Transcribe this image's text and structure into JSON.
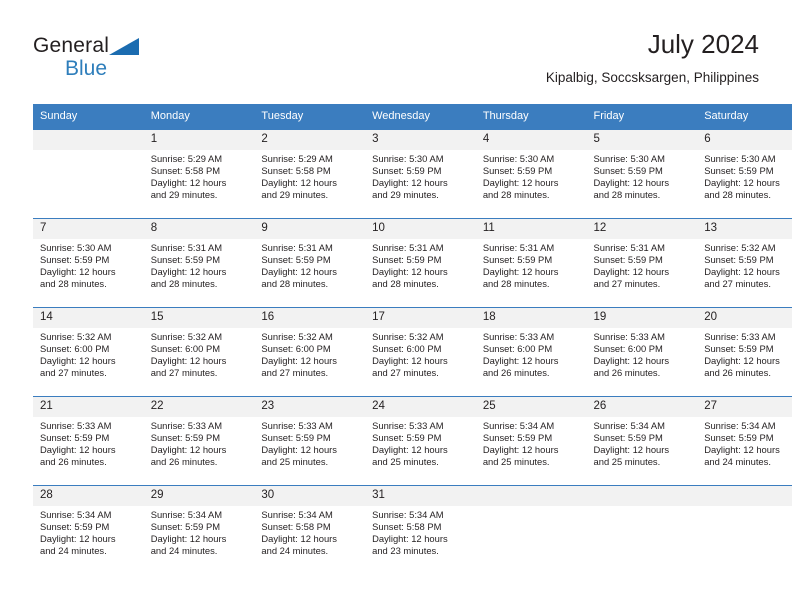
{
  "brand": {
    "name_top": "General",
    "name_bottom": "Blue",
    "triangle_color": "#1b6cb0",
    "blue_text_color": "#2e7ebb",
    "logo_icon": "triangle-flag-icon"
  },
  "header": {
    "title": "July 2024",
    "location": "Kipalbig, Soccsksargen, Philippines"
  },
  "theme": {
    "header_bg": "#3b7dbf",
    "header_text": "#ffffff",
    "daynum_bg": "#f2f2f2",
    "row_border": "#3b7dbf",
    "body_text": "#231f20"
  },
  "weekday_headers": [
    "Sunday",
    "Monday",
    "Tuesday",
    "Wednesday",
    "Thursday",
    "Friday",
    "Saturday"
  ],
  "weeks": [
    [
      {
        "day": "",
        "lines": []
      },
      {
        "day": "1",
        "lines": [
          "Sunrise: 5:29 AM",
          "Sunset: 5:58 PM",
          "Daylight: 12 hours",
          "and 29 minutes."
        ]
      },
      {
        "day": "2",
        "lines": [
          "Sunrise: 5:29 AM",
          "Sunset: 5:58 PM",
          "Daylight: 12 hours",
          "and 29 minutes."
        ]
      },
      {
        "day": "3",
        "lines": [
          "Sunrise: 5:30 AM",
          "Sunset: 5:59 PM",
          "Daylight: 12 hours",
          "and 29 minutes."
        ]
      },
      {
        "day": "4",
        "lines": [
          "Sunrise: 5:30 AM",
          "Sunset: 5:59 PM",
          "Daylight: 12 hours",
          "and 28 minutes."
        ]
      },
      {
        "day": "5",
        "lines": [
          "Sunrise: 5:30 AM",
          "Sunset: 5:59 PM",
          "Daylight: 12 hours",
          "and 28 minutes."
        ]
      },
      {
        "day": "6",
        "lines": [
          "Sunrise: 5:30 AM",
          "Sunset: 5:59 PM",
          "Daylight: 12 hours",
          "and 28 minutes."
        ]
      }
    ],
    [
      {
        "day": "7",
        "lines": [
          "Sunrise: 5:30 AM",
          "Sunset: 5:59 PM",
          "Daylight: 12 hours",
          "and 28 minutes."
        ]
      },
      {
        "day": "8",
        "lines": [
          "Sunrise: 5:31 AM",
          "Sunset: 5:59 PM",
          "Daylight: 12 hours",
          "and 28 minutes."
        ]
      },
      {
        "day": "9",
        "lines": [
          "Sunrise: 5:31 AM",
          "Sunset: 5:59 PM",
          "Daylight: 12 hours",
          "and 28 minutes."
        ]
      },
      {
        "day": "10",
        "lines": [
          "Sunrise: 5:31 AM",
          "Sunset: 5:59 PM",
          "Daylight: 12 hours",
          "and 28 minutes."
        ]
      },
      {
        "day": "11",
        "lines": [
          "Sunrise: 5:31 AM",
          "Sunset: 5:59 PM",
          "Daylight: 12 hours",
          "and 28 minutes."
        ]
      },
      {
        "day": "12",
        "lines": [
          "Sunrise: 5:31 AM",
          "Sunset: 5:59 PM",
          "Daylight: 12 hours",
          "and 27 minutes."
        ]
      },
      {
        "day": "13",
        "lines": [
          "Sunrise: 5:32 AM",
          "Sunset: 5:59 PM",
          "Daylight: 12 hours",
          "and 27 minutes."
        ]
      }
    ],
    [
      {
        "day": "14",
        "lines": [
          "Sunrise: 5:32 AM",
          "Sunset: 6:00 PM",
          "Daylight: 12 hours",
          "and 27 minutes."
        ]
      },
      {
        "day": "15",
        "lines": [
          "Sunrise: 5:32 AM",
          "Sunset: 6:00 PM",
          "Daylight: 12 hours",
          "and 27 minutes."
        ]
      },
      {
        "day": "16",
        "lines": [
          "Sunrise: 5:32 AM",
          "Sunset: 6:00 PM",
          "Daylight: 12 hours",
          "and 27 minutes."
        ]
      },
      {
        "day": "17",
        "lines": [
          "Sunrise: 5:32 AM",
          "Sunset: 6:00 PM",
          "Daylight: 12 hours",
          "and 27 minutes."
        ]
      },
      {
        "day": "18",
        "lines": [
          "Sunrise: 5:33 AM",
          "Sunset: 6:00 PM",
          "Daylight: 12 hours",
          "and 26 minutes."
        ]
      },
      {
        "day": "19",
        "lines": [
          "Sunrise: 5:33 AM",
          "Sunset: 6:00 PM",
          "Daylight: 12 hours",
          "and 26 minutes."
        ]
      },
      {
        "day": "20",
        "lines": [
          "Sunrise: 5:33 AM",
          "Sunset: 5:59 PM",
          "Daylight: 12 hours",
          "and 26 minutes."
        ]
      }
    ],
    [
      {
        "day": "21",
        "lines": [
          "Sunrise: 5:33 AM",
          "Sunset: 5:59 PM",
          "Daylight: 12 hours",
          "and 26 minutes."
        ]
      },
      {
        "day": "22",
        "lines": [
          "Sunrise: 5:33 AM",
          "Sunset: 5:59 PM",
          "Daylight: 12 hours",
          "and 26 minutes."
        ]
      },
      {
        "day": "23",
        "lines": [
          "Sunrise: 5:33 AM",
          "Sunset: 5:59 PM",
          "Daylight: 12 hours",
          "and 25 minutes."
        ]
      },
      {
        "day": "24",
        "lines": [
          "Sunrise: 5:33 AM",
          "Sunset: 5:59 PM",
          "Daylight: 12 hours",
          "and 25 minutes."
        ]
      },
      {
        "day": "25",
        "lines": [
          "Sunrise: 5:34 AM",
          "Sunset: 5:59 PM",
          "Daylight: 12 hours",
          "and 25 minutes."
        ]
      },
      {
        "day": "26",
        "lines": [
          "Sunrise: 5:34 AM",
          "Sunset: 5:59 PM",
          "Daylight: 12 hours",
          "and 25 minutes."
        ]
      },
      {
        "day": "27",
        "lines": [
          "Sunrise: 5:34 AM",
          "Sunset: 5:59 PM",
          "Daylight: 12 hours",
          "and 24 minutes."
        ]
      }
    ],
    [
      {
        "day": "28",
        "lines": [
          "Sunrise: 5:34 AM",
          "Sunset: 5:59 PM",
          "Daylight: 12 hours",
          "and 24 minutes."
        ]
      },
      {
        "day": "29",
        "lines": [
          "Sunrise: 5:34 AM",
          "Sunset: 5:59 PM",
          "Daylight: 12 hours",
          "and 24 minutes."
        ]
      },
      {
        "day": "30",
        "lines": [
          "Sunrise: 5:34 AM",
          "Sunset: 5:58 PM",
          "Daylight: 12 hours",
          "and 24 minutes."
        ]
      },
      {
        "day": "31",
        "lines": [
          "Sunrise: 5:34 AM",
          "Sunset: 5:58 PM",
          "Daylight: 12 hours",
          "and 23 minutes."
        ]
      },
      {
        "day": "",
        "lines": []
      },
      {
        "day": "",
        "lines": []
      },
      {
        "day": "",
        "lines": []
      }
    ]
  ]
}
